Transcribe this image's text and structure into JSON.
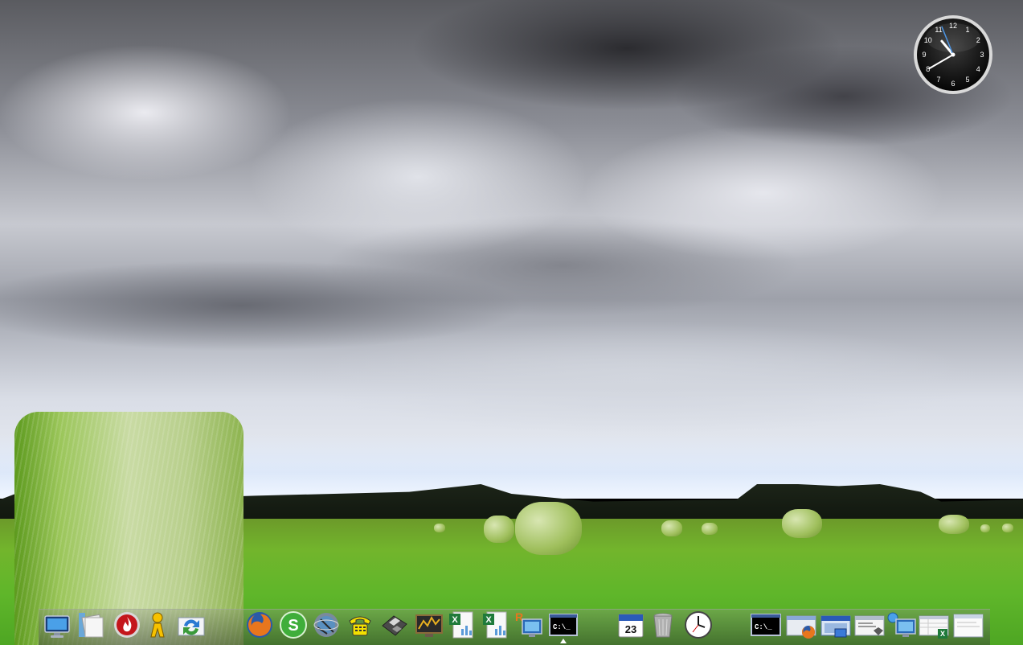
{
  "wallpaper": {
    "name": "hay-bales-field"
  },
  "clock_widget": {
    "numerals": [
      "12",
      "1",
      "2",
      "3",
      "4",
      "5",
      "6",
      "7",
      "8",
      "9",
      "10",
      "11"
    ],
    "time": "10:40"
  },
  "dock": {
    "left_group": [
      {
        "icon": "desktop-monitor-icon"
      },
      {
        "icon": "documents-folder-icon"
      },
      {
        "icon": "fire-app-icon"
      },
      {
        "icon": "aim-buddy-icon"
      },
      {
        "icon": "sync-arrows-icon"
      }
    ],
    "apps": [
      {
        "icon": "firefox-icon"
      },
      {
        "icon": "skype-icon"
      },
      {
        "icon": "globe-tool-icon"
      },
      {
        "icon": "phone-icon"
      },
      {
        "icon": "floppy-disk-icon"
      },
      {
        "icon": "system-monitor-icon"
      },
      {
        "icon": "excel-spreadsheet-icon"
      },
      {
        "icon": "excel-spreadsheet-icon"
      },
      {
        "icon": "remote-desktop-icon"
      },
      {
        "icon": "command-prompt-icon",
        "label": "C:\\_",
        "active": true
      }
    ],
    "right_group": [
      {
        "icon": "calendar-icon",
        "label": "23"
      },
      {
        "icon": "trash-can-icon"
      },
      {
        "icon": "analog-clock-icon"
      },
      {
        "icon": "command-prompt-window-icon",
        "label": "C:\\_"
      },
      {
        "icon": "firefox-window-icon"
      },
      {
        "icon": "app-window-icon"
      },
      {
        "icon": "dialog-window-icon"
      },
      {
        "icon": "computer-network-icon"
      },
      {
        "icon": "excel-window-icon"
      },
      {
        "icon": "blank-window-icon"
      }
    ]
  },
  "colors": {
    "dock_bg": "#4a5a40",
    "firefox_orange": "#e8761d",
    "skype_green": "#3fae3a",
    "excel_green": "#1f7a3a",
    "clock_face": "#111111",
    "clock_hand": "#3d8be0"
  }
}
